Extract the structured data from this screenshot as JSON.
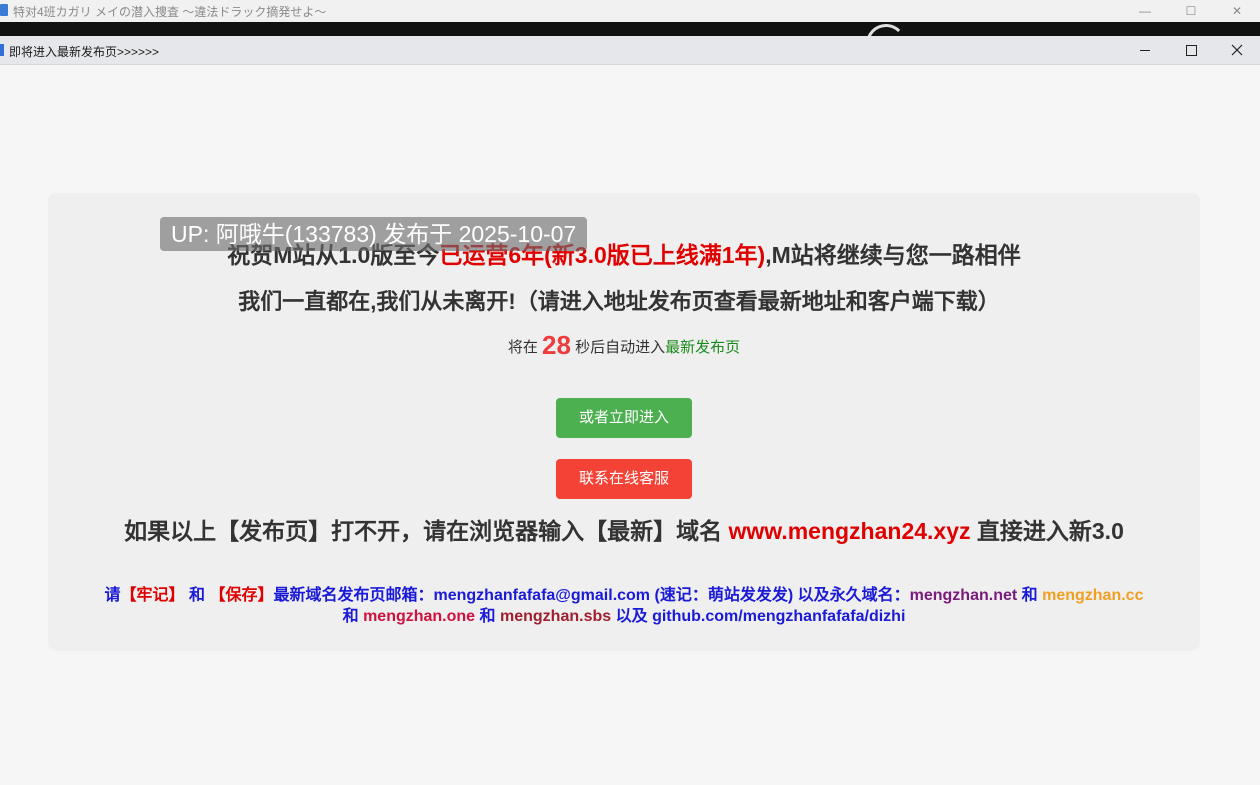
{
  "background_window": {
    "title": "特对4班カガリ メイの潜入捜査 ～違法ドラック摘発せよ～"
  },
  "window": {
    "title": "即将进入最新发布页>>>>>>",
    "controls": {
      "minimize": "—",
      "maximize": "☐",
      "close": "✕"
    }
  },
  "overlay": {
    "upload_badge": "UP: 阿哦牛(133783) 发布于 2025-10-07"
  },
  "page": {
    "line1_prefix": "祝贺M站从1.0版至今",
    "line1_highlight": "已运营6年(新3.0版已上线满1年)",
    "line1_suffix": ",M站将继续与您一路相伴",
    "line2": "我们一直都在,我们从未离开!（请进入地址发布页查看最新地址和客户端下载）",
    "countdown_prefix": "将在",
    "countdown_seconds": "28",
    "countdown_middle": "秒后自动进入",
    "countdown_link": "最新发布页",
    "enter_now_button": "或者立即进入",
    "support_button": "联系在线客服",
    "fallback_prefix": "如果以上【发布页】打不开，请在浏览器输入【最新】域名",
    "fallback_domain": "www.mengzhan24.xyz",
    "fallback_suffix": "直接进入新3.0",
    "note_please": "请",
    "note_remember": "【牢记】",
    "note_and1": "和",
    "note_save": "【保存】",
    "note_email_label": "最新域名发布页邮箱：",
    "note_email": "mengzhanfafafa@gmail.com",
    "note_mnemonic": "(速记：萌站发发发)",
    "note_permanent_label": "以及永久域名：",
    "note_domain1": "mengzhan.net",
    "note_and2": "和",
    "note_domain2": "mengzhan.cc",
    "note_and3": "和",
    "note_domain3": "mengzhan.one",
    "note_and4": "和",
    "note_domain4": "mengzhan.sbs",
    "note_also": "以及",
    "note_github": "github.com/mengzhanfafafa/dizhi"
  },
  "colors": {
    "highlight_red": "#e00000",
    "link_green": "#1a8a1a",
    "button_green": "#4caf50",
    "button_red": "#f44336",
    "note_blue": "#1a1ad8"
  }
}
